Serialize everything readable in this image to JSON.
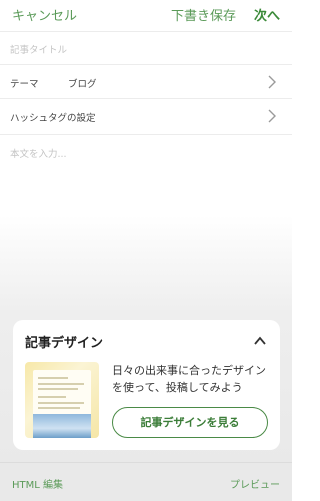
{
  "header": {
    "cancel_label": "キャンセル",
    "save_draft_label": "下書き保存",
    "next_label": "次へ"
  },
  "form": {
    "title_placeholder": "記事タイトル",
    "theme_label": "テーマ",
    "theme_value": "ブログ",
    "hashtag_label": "ハッシュタグの設定",
    "body_placeholder": "本文を入力..."
  },
  "design_card": {
    "title": "記事デザイン",
    "description": "日々の出来事に合ったデザインを使って、投稿してみよう",
    "button_label": "記事デザインを見る"
  },
  "footer": {
    "html_edit_label": "HTML 編集",
    "preview_label": "プレビュー"
  },
  "colors": {
    "accent": "#5a9a58",
    "accent_strong": "#3b7d38"
  }
}
